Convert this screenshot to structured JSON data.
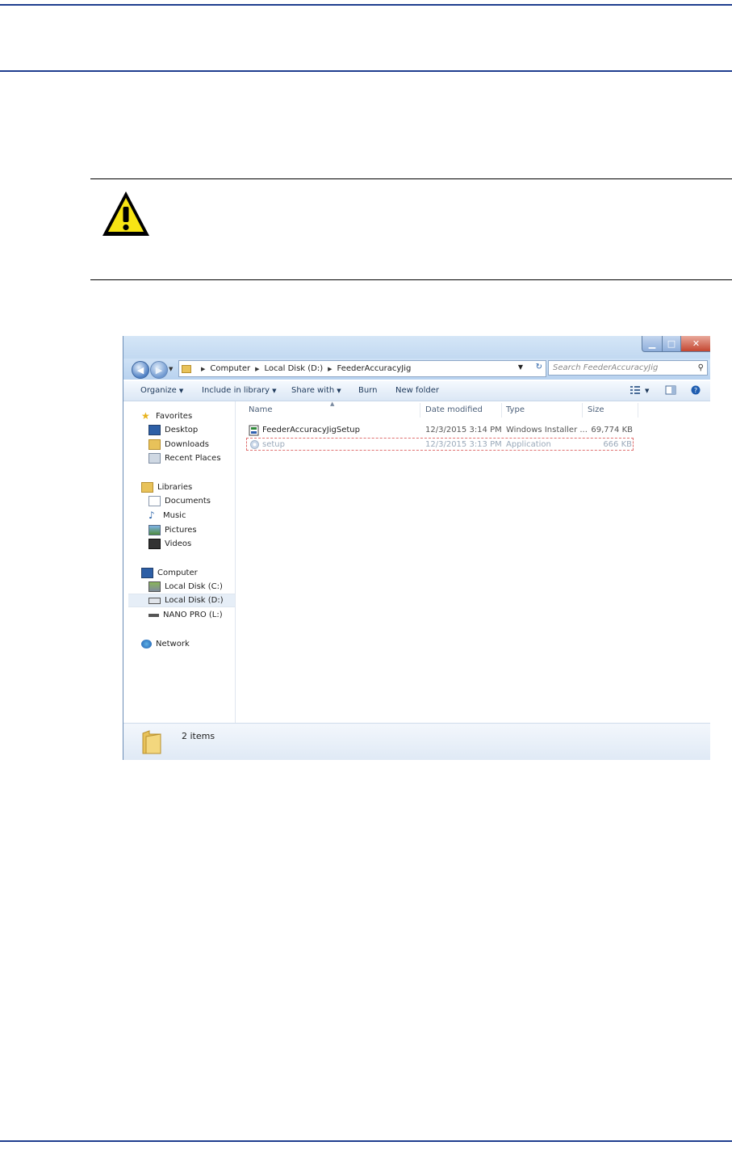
{
  "explorer": {
    "breadcrumb": [
      "Computer",
      "Local Disk (D:)",
      "FeederAccuracyJig"
    ],
    "search_placeholder": "Search FeederAccuracyJig",
    "toolbar": {
      "organize": "Organize",
      "include_in_library": "Include in library",
      "share_with": "Share with",
      "burn": "Burn",
      "new_folder": "New folder"
    },
    "nav": {
      "favorites": "Favorites",
      "desktop": "Desktop",
      "downloads": "Downloads",
      "recent_places": "Recent Places",
      "libraries": "Libraries",
      "documents": "Documents",
      "music": "Music",
      "pictures": "Pictures",
      "videos": "Videos",
      "computer": "Computer",
      "local_c": "Local Disk (C:)",
      "local_d": "Local Disk (D:)",
      "nano_pro": "NANO PRO (L:)",
      "network": "Network"
    },
    "columns": {
      "name": "Name",
      "date": "Date modified",
      "type": "Type",
      "size": "Size"
    },
    "files": [
      {
        "name": "FeederAccuracyJigSetup",
        "date": "12/3/2015 3:14 PM",
        "type": "Windows Installer ...",
        "size": "69,774 KB"
      },
      {
        "name": "setup",
        "date": "12/3/2015 3:13 PM",
        "type": "Application",
        "size": "666 KB"
      }
    ],
    "status": "2 items",
    "colors": {
      "accent": "#1f3e8f",
      "selection_border": "#e07070"
    }
  }
}
